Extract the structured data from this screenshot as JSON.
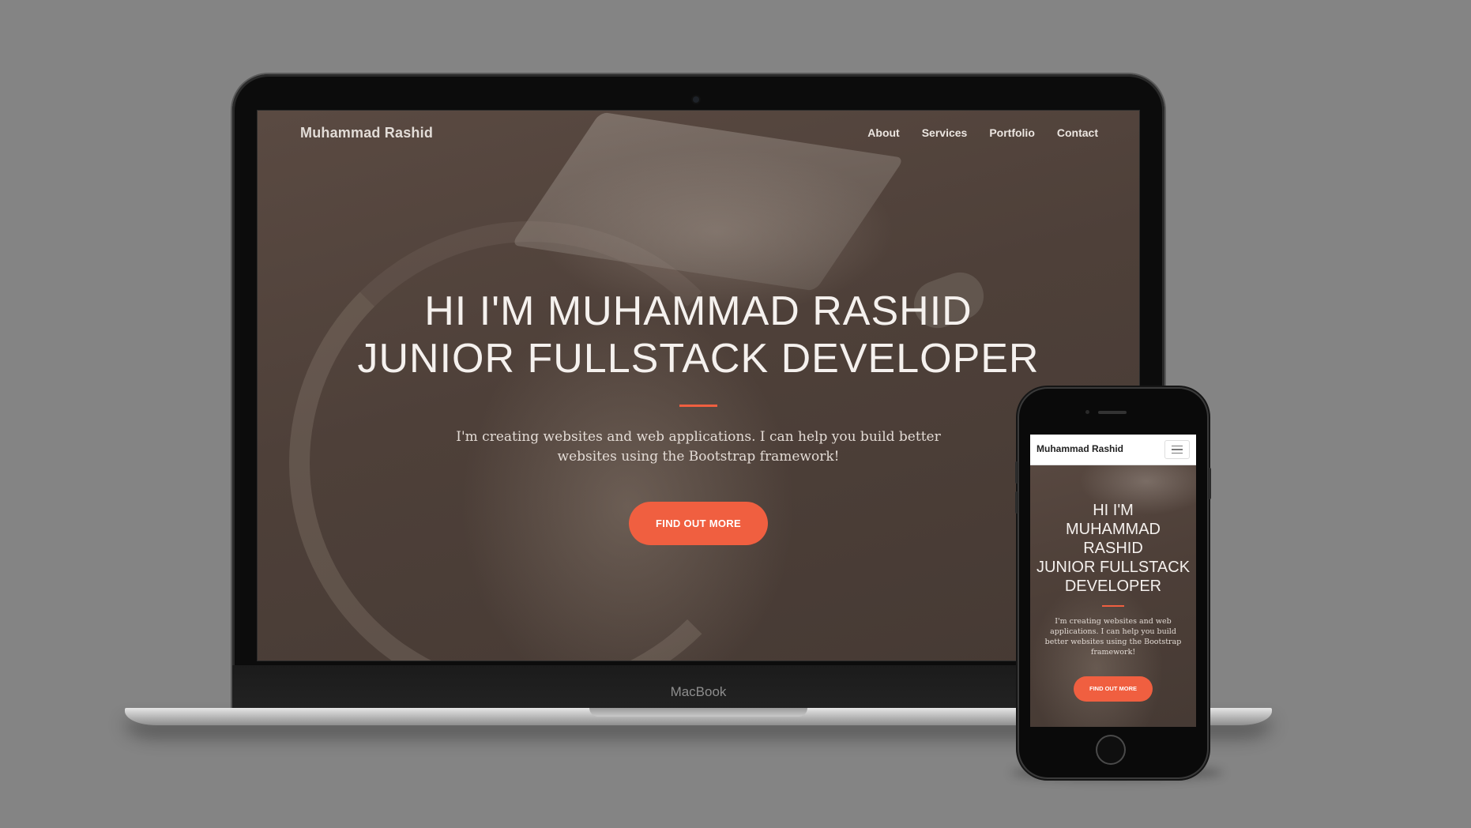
{
  "laptop": {
    "device_label": "MacBook"
  },
  "desktop_site": {
    "brand": "Muhammad Rashid",
    "nav": [
      "About",
      "Services",
      "Portfolio",
      "Contact"
    ],
    "hero": {
      "title_line1": "HI I'M MUHAMMAD RASHID",
      "title_line2": "JUNIOR FULLSTACK DEVELOPER",
      "text": "I'm creating websites and web applications. I can help you build better websites using the Bootstrap framework!",
      "button": "FIND OUT MORE"
    }
  },
  "mobile_site": {
    "brand": "Muhammad Rashid",
    "hero": {
      "title_lines": [
        "HI I'M",
        "MUHAMMAD",
        "RASHID",
        "JUNIOR FULLSTACK",
        "DEVELOPER"
      ],
      "text": "I'm creating websites and web applications. I can help you build better websites using the Bootstrap framework!",
      "button": "FIND OUT MORE"
    }
  },
  "colors": {
    "background": "#848484",
    "accent": "#f05f40",
    "hero_overlay": "#4e4039"
  }
}
